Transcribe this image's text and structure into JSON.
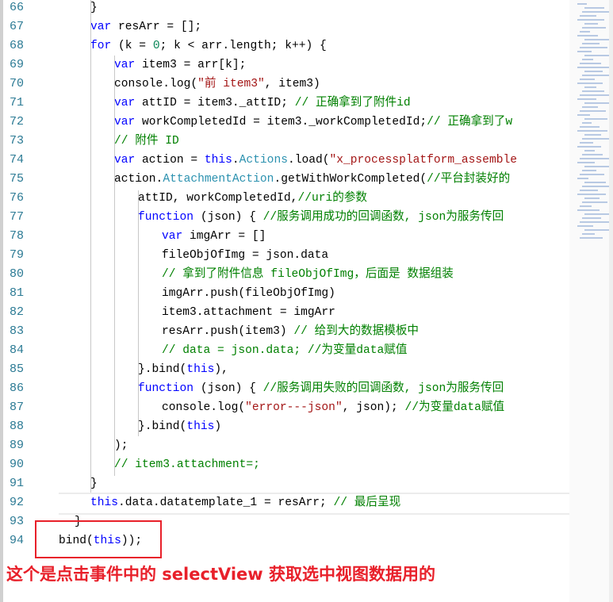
{
  "editor": {
    "lines": [
      {
        "n": "66",
        "i": 1,
        "html": "}"
      },
      {
        "n": "67",
        "i": 1,
        "html": "<span class=kw>var</span> resArr = [];"
      },
      {
        "n": "68",
        "i": 1,
        "html": "<span class=kw>for</span> (k = <span class=nu>0</span>; k &lt; arr.length; k++) {"
      },
      {
        "n": "69",
        "i": 2,
        "html": "<span class=kw>var</span> item3 = arr[k];"
      },
      {
        "n": "70",
        "i": 2,
        "html": "console.log(<span class=st>\"前 item3\"</span>, item3)"
      },
      {
        "n": "71",
        "i": 2,
        "html": "<span class=kw>var</span> attID = item3._attID; <span class=cm>// 正确拿到了附件id</span>"
      },
      {
        "n": "72",
        "i": 2,
        "html": "<span class=kw>var</span> workCompletedId = item3._workCompletedId;<span class=cm>// 正确拿到了w</span>"
      },
      {
        "n": "73",
        "i": 2,
        "html": "<span class=cm>// 附件 ID</span>"
      },
      {
        "n": "74",
        "i": 2,
        "html": "<span class=kw>var</span> action = <span class=kw>this</span>.<span class=ty>Actions</span>.load(<span class=st>\"x_processplatform_assemble</span>"
      },
      {
        "n": "75",
        "i": 2,
        "html": "action.<span class=ty>AttachmentAction</span>.getWithWorkCompleted(<span class=cm>//平台封装好的</span>"
      },
      {
        "n": "76",
        "i": 3,
        "html": "attID, workCompletedId,<span class=cm>//uri的参数</span>"
      },
      {
        "n": "77",
        "i": 3,
        "html": "<span class=kw>function</span> (json) { <span class=cm>//服务调用成功的回调函数, json为服务传回</span>"
      },
      {
        "n": "78",
        "i": 4,
        "html": "<span class=kw>var</span> imgArr = []"
      },
      {
        "n": "79",
        "i": 4,
        "html": "fileObjOfImg = json.data"
      },
      {
        "n": "80",
        "i": 4,
        "html": "<span class=cm>// 拿到了附件信息 fileObjOfImg，后面是 数据组装</span>"
      },
      {
        "n": "81",
        "i": 4,
        "html": "imgArr.push(fileObjOfImg)"
      },
      {
        "n": "82",
        "i": 4,
        "html": "item3.attachment = imgArr"
      },
      {
        "n": "83",
        "i": 4,
        "html": "resArr.push(item3) <span class=cm>// 给到大的数据模板中</span>"
      },
      {
        "n": "84",
        "i": 4,
        "html": "<span class=cm>// data = json.data; //为变量data赋值</span>"
      },
      {
        "n": "85",
        "i": 3,
        "html": "}.bind(<span class=kw>this</span>),"
      },
      {
        "n": "86",
        "i": 3,
        "html": "<span class=kw>function</span> (json) { <span class=cm>//服务调用失败的回调函数, json为服务传回</span>"
      },
      {
        "n": "87",
        "i": 4,
        "html": "console.log(<span class=st>\"error---json\"</span>, json); <span class=cm>//为变量data赋值</span>"
      },
      {
        "n": "88",
        "i": 3,
        "html": "}.bind(<span class=kw>this</span>)"
      },
      {
        "n": "89",
        "i": 2,
        "html": ");"
      },
      {
        "n": "90",
        "i": 2,
        "html": "<span class=cm>// item3.attachment=;</span>"
      },
      {
        "n": "91",
        "i": 1,
        "html": "}"
      },
      {
        "n": "92",
        "i": 1,
        "html": "<span class=kw>this</span>.data.datatemplate_1 = resArr; <span class=cm>// 最后呈现</span>"
      },
      {
        "n": "93",
        "i": 0.5,
        "html": "}"
      },
      {
        "n": "94",
        "i": 0,
        "html": "bind(<span class=kw>this</span>));"
      }
    ]
  },
  "annotation": {
    "text": "这个是点击事件中的 selectView 获取选中视图数据用的"
  }
}
